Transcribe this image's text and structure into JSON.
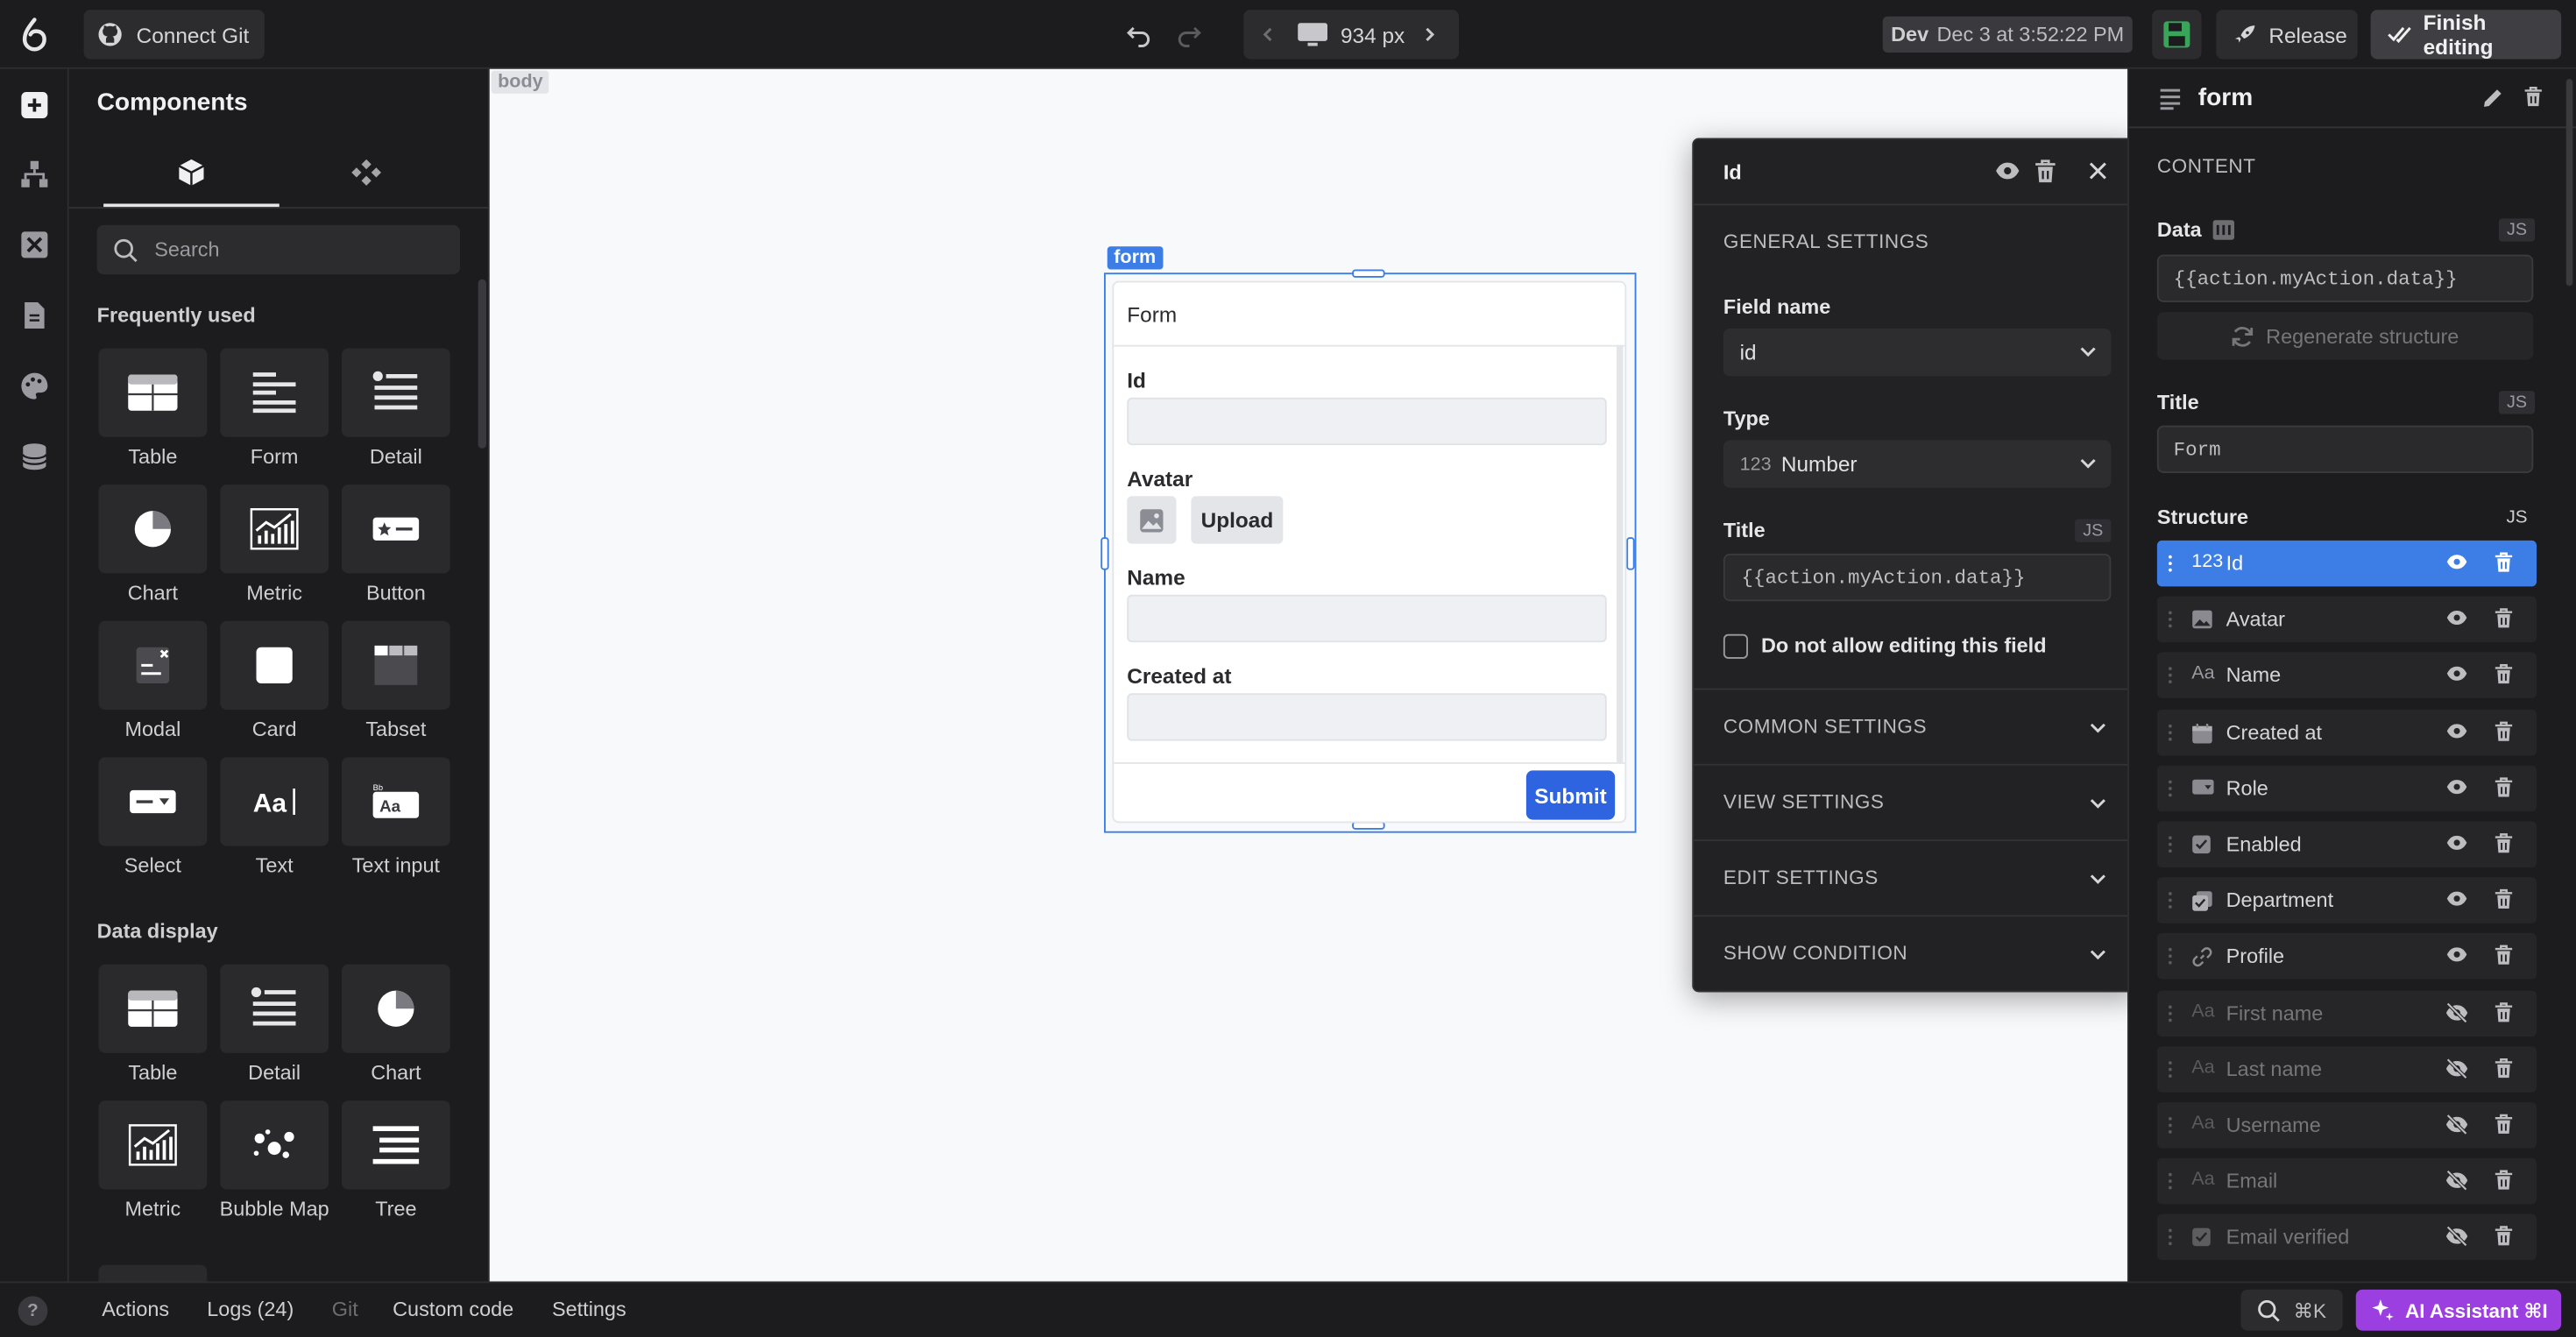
{
  "topbar": {
    "connect_git": "Connect Git",
    "viewport_width": "934 px",
    "env_label": "Dev",
    "env_timestamp": "Dec 3 at 3:52:22 PM",
    "release_label": "Release",
    "finish_label": "Finish editing"
  },
  "components_panel": {
    "title": "Components",
    "search_placeholder": "Search",
    "frequently_used_title": "Frequently used",
    "frequently_used": [
      "Table",
      "Form",
      "Detail",
      "Chart",
      "Metric",
      "Button",
      "Modal",
      "Card",
      "Tabset",
      "Select",
      "Text",
      "Text input"
    ],
    "data_display_title": "Data display",
    "data_display": [
      "Table",
      "Detail",
      "Chart",
      "Metric",
      "Bubble Map",
      "Tree"
    ]
  },
  "canvas": {
    "body_tag": "body",
    "form_tag": "form",
    "form_title": "Form",
    "fields": {
      "id": "Id",
      "avatar": "Avatar",
      "upload": "Upload",
      "name": "Name",
      "created_at": "Created at"
    },
    "submit_label": "Submit"
  },
  "field_popup": {
    "title": "Id",
    "general_settings": "GENERAL SETTINGS",
    "field_name_label": "Field name",
    "field_name_value": "id",
    "type_label": "Type",
    "type_icon_text": "123",
    "type_value": "Number",
    "title_label": "Title",
    "title_value": "{{action.myAction.data}}",
    "js_badge": "JS",
    "no_edit_label": "Do not allow editing this field",
    "no_edit_checked": false,
    "common_settings": "COMMON SETTINGS",
    "view_settings": "VIEW SETTINGS",
    "edit_settings": "EDIT SETTINGS",
    "show_condition": "SHOW CONDITION"
  },
  "right_panel": {
    "component_name": "form",
    "content_title": "CONTENT",
    "data_label": "Data",
    "data_value": "{{action.myAction.data}}",
    "regenerate_label": "Regenerate structure",
    "title_label": "Title",
    "title_value": "Form",
    "structure_label": "Structure",
    "js_badge": "JS",
    "structure": [
      {
        "label": "Id",
        "icon": "number-icon",
        "icon_text": "123",
        "visible": true,
        "selected": true
      },
      {
        "label": "Avatar",
        "icon": "image-icon",
        "visible": true,
        "selected": false
      },
      {
        "label": "Name",
        "icon": "text-type-icon",
        "icon_text": "Aa",
        "visible": true,
        "selected": false
      },
      {
        "label": "Created at",
        "icon": "calendar-icon",
        "visible": true,
        "selected": false
      },
      {
        "label": "Role",
        "icon": "select-icon",
        "visible": true,
        "selected": false
      },
      {
        "label": "Enabled",
        "icon": "checkbox-icon",
        "visible": true,
        "selected": false
      },
      {
        "label": "Department",
        "icon": "multi-checkbox-icon",
        "visible": true,
        "selected": false
      },
      {
        "label": "Profile",
        "icon": "link-icon",
        "visible": true,
        "selected": false
      },
      {
        "label": "First name",
        "icon": "text-type-icon",
        "icon_text": "Aa",
        "visible": false,
        "selected": false
      },
      {
        "label": "Last name",
        "icon": "text-type-icon",
        "icon_text": "Aa",
        "visible": false,
        "selected": false
      },
      {
        "label": "Username",
        "icon": "text-type-icon",
        "icon_text": "Aa",
        "visible": false,
        "selected": false
      },
      {
        "label": "Email",
        "icon": "text-type-icon",
        "icon_text": "Aa",
        "visible": false,
        "selected": false
      },
      {
        "label": "Email verified",
        "icon": "checkbox-icon",
        "visible": false,
        "selected": false
      }
    ]
  },
  "bottom_bar": {
    "tabs": [
      "Actions",
      "Logs (24)",
      "Git",
      "Custom code",
      "Settings"
    ],
    "shortcut": "⌘K",
    "ai_label": "AI Assistant ⌘I"
  },
  "colors": {
    "accent_blue": "#3d7ee6",
    "submit_blue": "#2f64e0",
    "ai_purple": "#9b3fe0",
    "save_green": "#3aa45a"
  }
}
